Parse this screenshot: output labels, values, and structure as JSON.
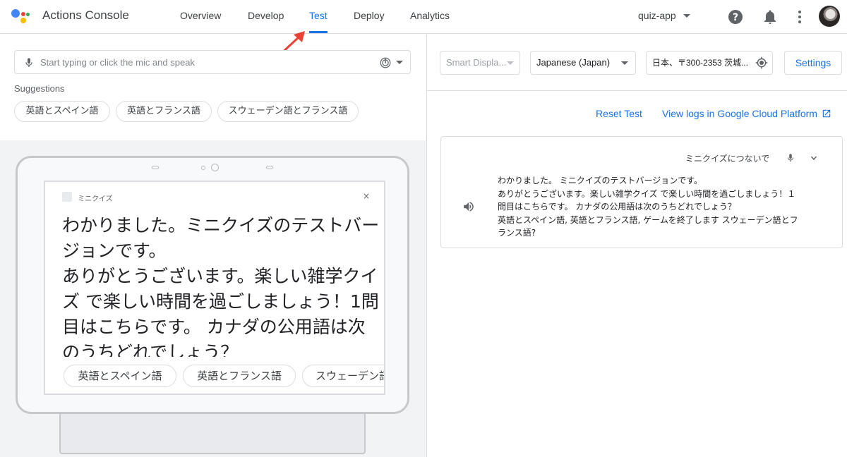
{
  "header": {
    "app_title": "Actions Console",
    "tabs": [
      {
        "label": "Overview"
      },
      {
        "label": "Develop"
      },
      {
        "label": "Test"
      },
      {
        "label": "Deploy"
      },
      {
        "label": "Analytics"
      }
    ],
    "active_tab": "Test",
    "project_name": "quiz-app",
    "icons": [
      "help-icon",
      "notifications-icon",
      "more-vert-icon"
    ],
    "accent_color": "#1a73e8"
  },
  "input": {
    "placeholder": "Start typing or click the mic and speak"
  },
  "suggestions": {
    "label": "Suggestions",
    "chips": [
      "英語とスペイン語",
      "英語とフランス語",
      "スウェーデン語とフランス語"
    ]
  },
  "device": {
    "app_name": "ミニクイズ",
    "close_glyph": "×",
    "display_text": "わかりました。ミニクイズのテストバージョンです。\nありがとうございます。楽しい雑学クイズ で楽しい時間を過ごしましょう！1問目はこちらです。 カナダの公用語は次のうちどれでしょう？",
    "chips": [
      "英語とスペイン語",
      "英語とフランス語",
      "スウェーデン語"
    ]
  },
  "controls": {
    "surface": "Smart Displa...",
    "language": "Japanese (Japan)",
    "location": "日本、〒300-2353 茨城...",
    "settings_label": "Settings"
  },
  "links": {
    "reset": "Reset Test",
    "logs": "View logs in Google Cloud Platform"
  },
  "conversation": {
    "user_utterance": "ミニクイズにつないで",
    "response_lines": [
      "わかりました。 ミニクイズのテストバージョンです。",
      "ありがとうございます。楽しい雑学クイズ で楽しい時間を過ごしましょう！１",
      "問目はこちらです。 カナダの公用語は次のうちどれでしょう？",
      "英語とスペイン語, 英語とフランス語, ゲームを終了します スウェーデン語とフ",
      "ランス語?"
    ]
  }
}
